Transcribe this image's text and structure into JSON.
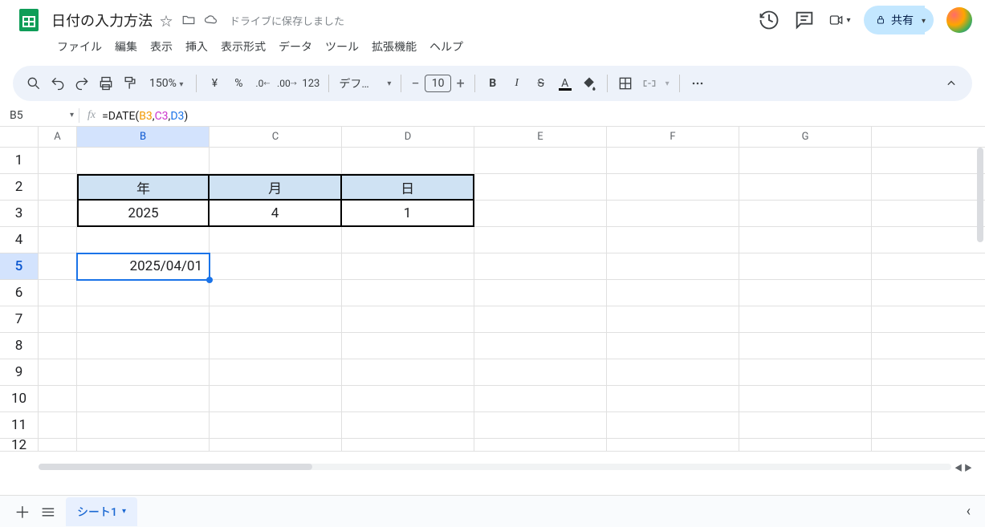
{
  "document": {
    "title": "日付の入力方法",
    "save_status": "ドライブに保存しました"
  },
  "menu": {
    "items": [
      "ファイル",
      "編集",
      "表示",
      "挿入",
      "表示形式",
      "データ",
      "ツール",
      "拡張機能",
      "ヘルプ"
    ]
  },
  "toolbar": {
    "zoom": "150%",
    "currency": "¥",
    "percent": "%",
    "dec_dec": ".0",
    "dec_inc": ".00",
    "num_fmt": "123",
    "font_name": "デフォ...",
    "font_size": "10",
    "share_label": "共有"
  },
  "name_box": {
    "ref": "B5"
  },
  "formula": {
    "prefix": "=",
    "fn": "DATE",
    "args": [
      "B3",
      "C3",
      "D3"
    ]
  },
  "columns": [
    "A",
    "B",
    "C",
    "D",
    "E",
    "F",
    "G"
  ],
  "rows": [
    "1",
    "2",
    "3",
    "4",
    "5",
    "6",
    "7",
    "8",
    "9",
    "10",
    "11",
    "12"
  ],
  "table_header": {
    "B2": "年",
    "C2": "月",
    "D2": "日"
  },
  "table_values": {
    "B3": "2025",
    "C3": "4",
    "D3": "1"
  },
  "result_cell": {
    "ref": "B5",
    "value": "2025/04/01"
  },
  "sheet_tab": {
    "name": "シート1"
  }
}
